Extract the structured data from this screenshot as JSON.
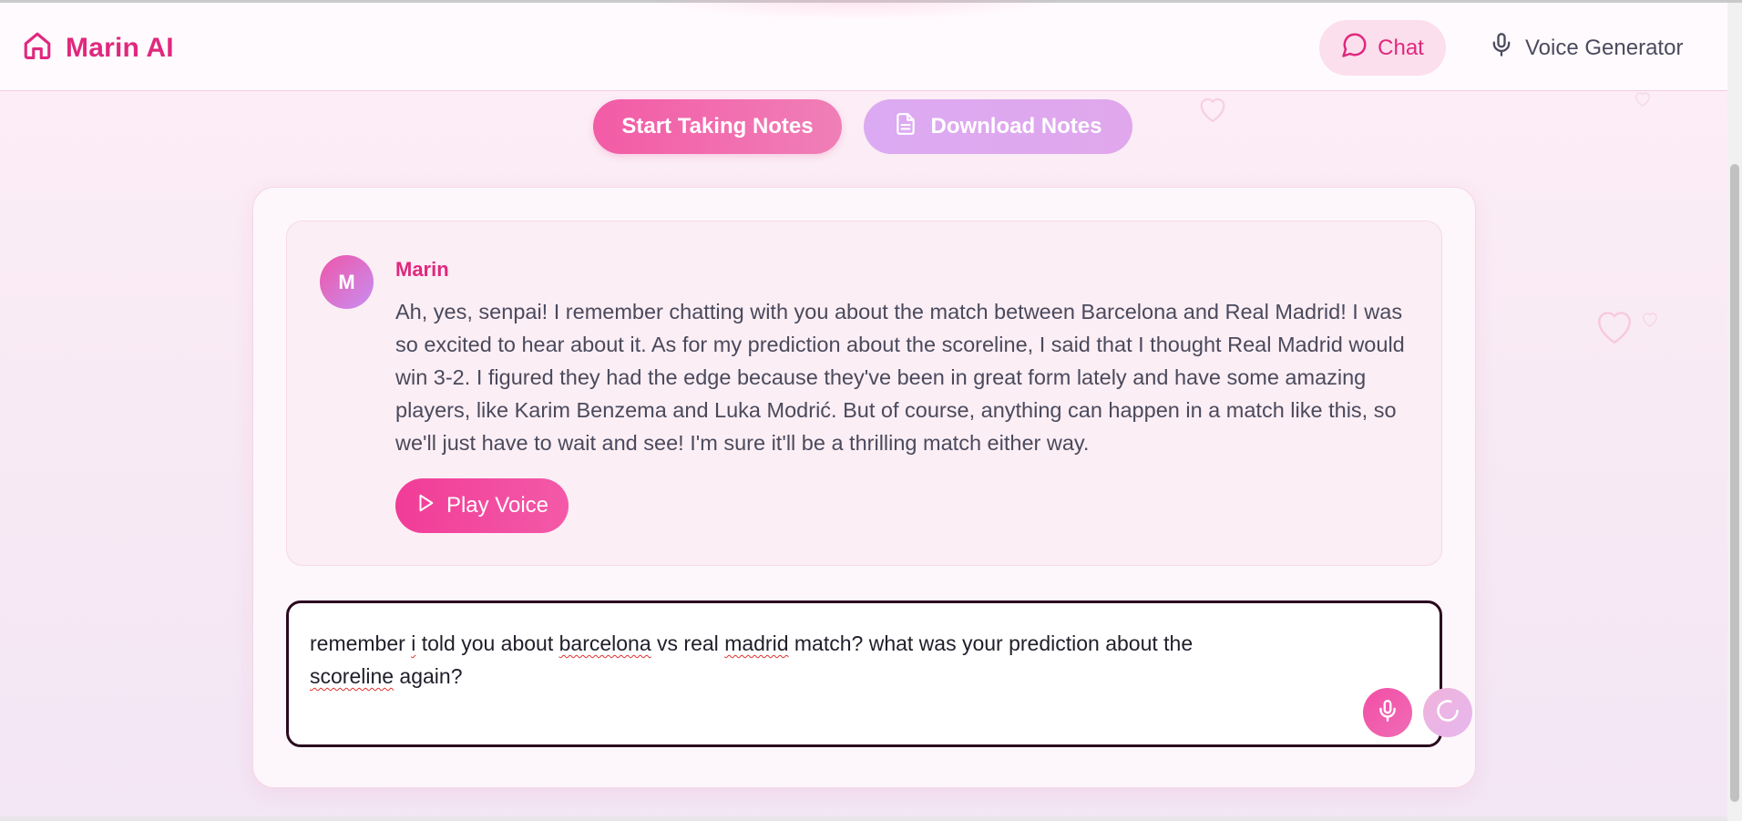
{
  "header": {
    "brand": "Marin AI",
    "nav": {
      "chat_label": "Chat",
      "voice_label": "Voice Generator"
    }
  },
  "actions": {
    "start_notes_label": "Start Taking Notes",
    "download_notes_label": "Download Notes"
  },
  "chat": {
    "message": {
      "avatar_letter": "M",
      "sender": "Marin",
      "text": "Ah, yes, senpai! I remember chatting with you about the match between Barcelona and Real Madrid! I was so excited to hear about it. As for my prediction about the scoreline, I said that I thought Real Madrid would win 3-2. I figured they had the edge because they've been in great form lately and have some amazing players, like Karim Benzema and Luka Modrić. But of course, anything can happen in a match like this, so we'll just have to wait and see! I'm sure it'll be a thrilling match either way.",
      "play_label": "Play Voice"
    },
    "input": {
      "parts": [
        "remember ",
        "i",
        " told you about ",
        "barcelona",
        " vs real ",
        "madrid",
        " match? what was your prediction about the ",
        "scoreline",
        " again?"
      ]
    }
  },
  "colors": {
    "brand": "#e0287e",
    "accent_pink": "#f35ba6",
    "accent_lilac": "#dcaaf2"
  },
  "icons": {
    "brand": "home-icon",
    "chat": "message-circle-icon",
    "voice": "microphone-icon",
    "download": "file-text-icon",
    "play": "play-icon",
    "mic": "microphone-icon",
    "send": "loading-spinner-icon"
  }
}
